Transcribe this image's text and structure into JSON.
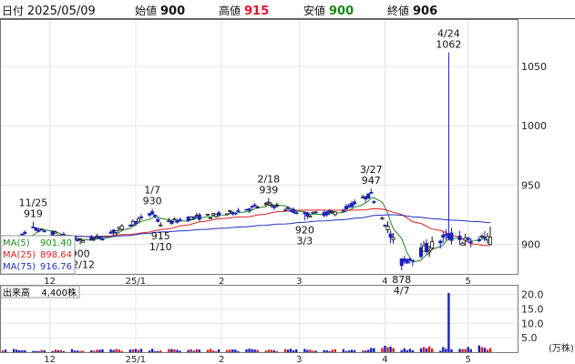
{
  "header": {
    "date_label": "日付",
    "date_value": "2025/05/09",
    "open_label": "始値",
    "open_value": "900",
    "high_label": "高値",
    "high_value": "915",
    "low_label": "安値",
    "low_value": "900",
    "close_label": "終値",
    "close_value": "906",
    "high_color": "#e8102a",
    "low_color": "#138a13"
  },
  "chart_data": [
    {
      "type": "candlestick",
      "y_ticks": [
        900,
        950,
        1000,
        1050
      ],
      "ylim": [
        875,
        1090
      ],
      "x_ticks": [
        "12",
        "25/1",
        "2",
        "3",
        "4",
        "5"
      ],
      "annotations": [
        {
          "date": "11/25",
          "value": "919"
        },
        {
          "date": "12/12",
          "value": "900"
        },
        {
          "date": "1/7",
          "value": "930"
        },
        {
          "date": "1/10",
          "value": "915"
        },
        {
          "date": "2/18",
          "value": "939"
        },
        {
          "date": "3/3",
          "value": "920"
        },
        {
          "date": "3/27",
          "value": "947"
        },
        {
          "date": "4/7",
          "value": "878"
        },
        {
          "date": "4/24",
          "value": "1062"
        }
      ],
      "moving_averages": [
        {
          "name": "MA(5)",
          "value": "901.40",
          "color": "#1a8a1a"
        },
        {
          "name": "MA(25)",
          "value": "898.64",
          "color": "#e02020"
        },
        {
          "name": "MA(75)",
          "value": "916.76",
          "color": "#2030c0"
        }
      ],
      "ohlc_keypoints": [
        [
          "11/15",
          898
        ],
        [
          "11/25",
          913
        ],
        [
          "12/1",
          910
        ],
        [
          "12/12",
          903
        ],
        [
          "12/20",
          906
        ],
        [
          "1/7",
          926
        ],
        [
          "1/10",
          917
        ],
        [
          "1/20",
          922
        ],
        [
          "2/1",
          925
        ],
        [
          "2/18",
          934
        ],
        [
          "3/3",
          925
        ],
        [
          "3/15",
          927
        ],
        [
          "3/27",
          942
        ],
        [
          "4/1",
          918
        ],
        [
          "4/7",
          885
        ],
        [
          "4/15",
          895
        ],
        [
          "4/24",
          907
        ],
        [
          "5/1",
          902
        ],
        [
          "5/9",
          906
        ]
      ]
    },
    {
      "type": "bar",
      "label": "出来高",
      "last_value": "4,400株",
      "y_ticks": [
        "20.0",
        "15.0",
        "10.0",
        "5.0"
      ],
      "unit": "(万株)",
      "peak": {
        "date": "4/24",
        "value": 20.5
      },
      "ylim": [
        0,
        23
      ]
    }
  ]
}
